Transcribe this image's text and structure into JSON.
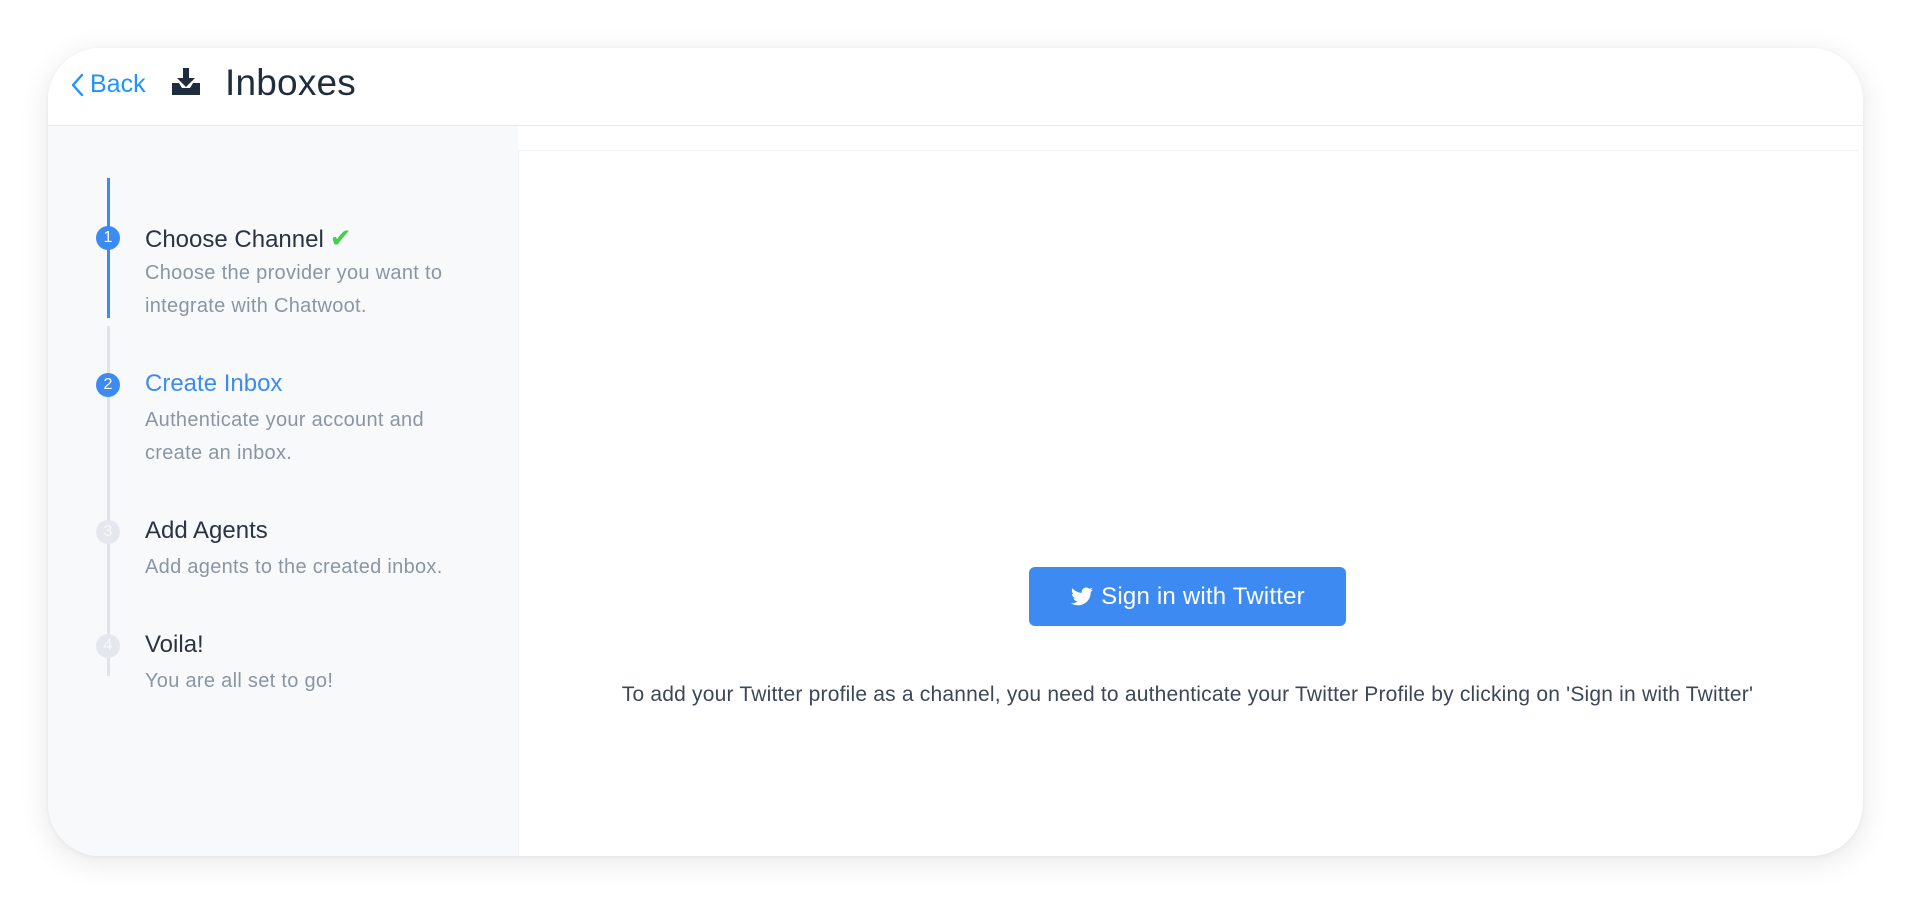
{
  "header": {
    "back_label": "Back",
    "title": "Inboxes",
    "icon": "inbox-download-icon"
  },
  "steps": [
    {
      "number": "1",
      "label": "Choose Channel",
      "desc": "Choose the provider you want to integrate with Chatwoot.",
      "status": "completed"
    },
    {
      "number": "2",
      "label": "Create Inbox",
      "desc": "Authenticate your account and create an inbox.",
      "status": "active"
    },
    {
      "number": "3",
      "label": "Add Agents",
      "desc": "Add agents to the created inbox.",
      "status": "pending"
    },
    {
      "number": "4",
      "label": "Voila!",
      "desc": "You are all set to go!",
      "status": "pending"
    }
  ],
  "main": {
    "button_label": "Sign in with Twitter",
    "button_icon": "twitter-icon",
    "help_text": "To add your Twitter profile as a channel, you need to authenticate your Twitter Profile by clicking on 'Sign in with Twitter'"
  },
  "colors": {
    "accent": "#1f93ff",
    "step_active": "#3d8bf2",
    "check": "#44ce4b",
    "button": "#3d8bf2",
    "pending_step": "#dfe4ea"
  }
}
